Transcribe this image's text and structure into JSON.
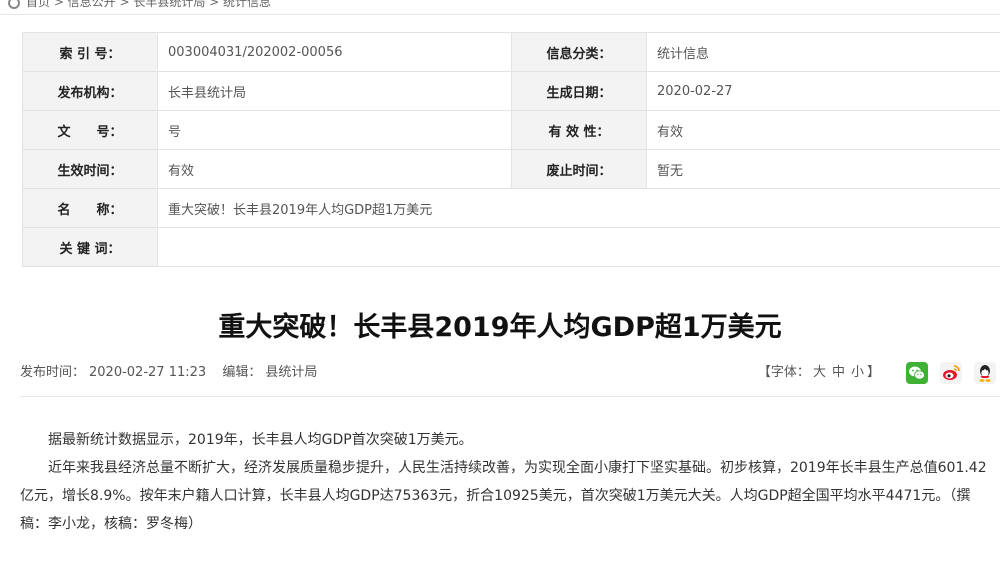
{
  "breadcrumb": {
    "text": "首页 > 信息公开 > 长丰县统计局 > 统计信息"
  },
  "meta": {
    "rows": [
      {
        "k1": "索 引 号：",
        "v1": "003004031/202002-00056",
        "k2": "信息分类：",
        "v2": "统计信息"
      },
      {
        "k1": "发布机构：",
        "v1": "长丰县统计局",
        "k2": "生成日期：",
        "v2": "2020-02-27"
      },
      {
        "k1": "文　　号：",
        "v1": "号",
        "k2": "有 效 性：",
        "v2": "有效"
      },
      {
        "k1": "生效时间：",
        "v1": "有效",
        "k2": "废止时间：",
        "v2": "暂无"
      }
    ],
    "name_label": "名　　称：",
    "name_value": "重大突破！长丰县2019年人均GDP超1万美元",
    "keyword_label": "关 键 词：",
    "keyword_value": ""
  },
  "article": {
    "title": "重大突破！长丰县2019年人均GDP超1万美元",
    "publish_label": "发布时间：",
    "publish_time": "2020-02-27 11:23",
    "editor_label": "编辑：",
    "editor": "县统计局",
    "font_open": "【字体：",
    "font_large": "大",
    "font_medium": "中",
    "font_small": "小",
    "font_close": "】",
    "paragraphs": [
      "据最新统计数据显示，2019年，长丰县人均GDP首次突破1万美元。",
      "近年来我县经济总量不断扩大，经济发展质量稳步提升，人民生活持续改善，为实现全面小康打下坚实基础。初步核算，2019年长丰县生产总值601.42亿元，增长8.9%。按年末户籍人口计算，长丰县人均GDP达75363元，折合10925美元，首次突破1万美元大关。人均GDP超全国平均水平4471元。（撰稿：李小龙，核稿：罗冬梅）"
    ]
  },
  "icons": {
    "wechat": "wechat-share-icon",
    "weibo": "weibo-share-icon",
    "qq": "qq-share-icon"
  },
  "colors": {
    "wechat": "#3fb134",
    "weibo_red": "#e6162d",
    "weibo_orange": "#f7a11b",
    "qq_yellow": "#f5b400"
  }
}
